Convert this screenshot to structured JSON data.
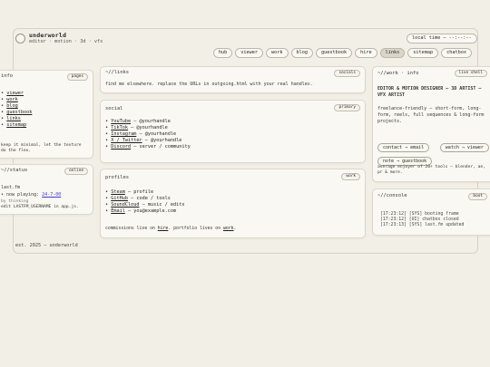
{
  "site": {
    "title": "underworld",
    "subtitle": "editor · motion · 3d · vfx"
  },
  "time_pill": "local time — --:--:--",
  "nav": [
    "hub",
    "viewer",
    "work",
    "blog",
    "guestbook",
    "hire",
    "links",
    "sitemap",
    "chatbox"
  ],
  "nav_active": "links",
  "info": {
    "title": "info",
    "badge": "pages",
    "items": [
      "viewer",
      "work",
      "blog",
      "guestbook",
      "links",
      "sitemap"
    ],
    "note": "keep it minimal, let the texture do the flex."
  },
  "status": {
    "title": "~//status",
    "badge": "online",
    "source": "last.fm",
    "playing_label": "• now playing:",
    "playing_value": "24-7-00",
    "by": "by thinking",
    "hint": "edit LASTFM_USERNAME in app.js."
  },
  "links": {
    "title": "~//links",
    "badge": "socials",
    "text": "find me elsewhere. replace the URLs in outgoing.html with your real handles."
  },
  "social": {
    "title": "social",
    "badge": "primary",
    "items": [
      {
        "name": "YouTube",
        "handle": " — @yourhandle"
      },
      {
        "name": "TikTok",
        "handle": " — @yourhandle"
      },
      {
        "name": "Instagram",
        "handle": " — @yourhandle"
      },
      {
        "name": "X / Twitter",
        "handle": " — @yourhandle"
      },
      {
        "name": "Discord",
        "handle": " — server / community"
      }
    ]
  },
  "profiles": {
    "title": "profiles",
    "badge": "work",
    "items": [
      {
        "name": "Steam",
        "handle": " — profile"
      },
      {
        "name": "GitHub",
        "handle": " — code / tools"
      },
      {
        "name": "SoundCloud",
        "handle": " — music / edits"
      },
      {
        "name": "Email",
        "handle": " — you@example.com"
      }
    ],
    "note_a": "commissions live on ",
    "note_hire": "hire",
    "note_b": ". portfolio lives on ",
    "note_work": "work",
    "note_c": "."
  },
  "work_info": {
    "title": "~//work · info",
    "badge": "live shell",
    "heading": "EDITOR & MOTION DESIGNER — 3D ARTIST — VFX ARTIST",
    "text": "freelance-friendly — short-form, long-form, reels, full sequences & long-form projects.",
    "buttons": [
      "contact → email",
      "watch → viewer",
      "note → guestbook"
    ],
    "avg": "average enjoyer of 20+ tools — blender, ae, pr & more."
  },
  "console": {
    "title": "~//console",
    "badge": "boot",
    "lines": [
      "[17:23:12] [SYS] booting frame",
      "[17:23:12] [UI] chatbox closed",
      "[17:23:13] [SYS] last.fm updated"
    ]
  },
  "footer": "est. 2025 — underworld",
  "colors": {
    "background": "#f2efe7",
    "card": "#faf8f3",
    "accent_link": "#3b3bd0"
  }
}
